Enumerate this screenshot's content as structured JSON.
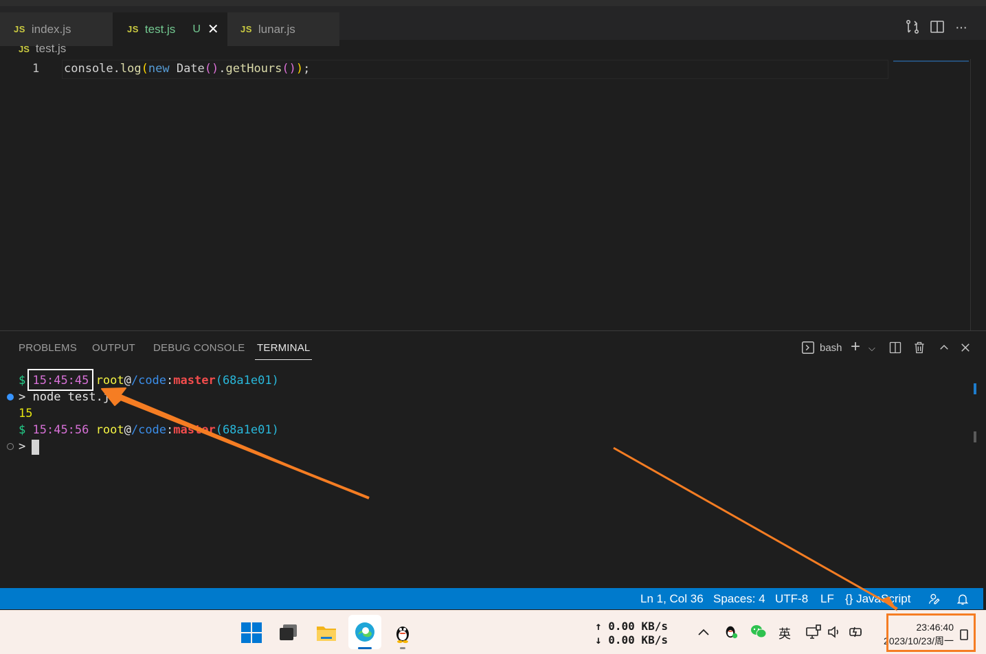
{
  "tabs": [
    {
      "icon_text": "JS",
      "label": "index.js"
    },
    {
      "icon_text": "JS",
      "label": "test.js",
      "status": "U"
    },
    {
      "icon_text": "JS",
      "label": "lunar.js"
    }
  ],
  "tab_actions": [
    "open-changes-icon",
    "split-editor-icon",
    "more-actions-icon"
  ],
  "more_glyph": "···",
  "breadcrumb": {
    "icon_text": "JS",
    "file": "test.js"
  },
  "editor": {
    "line_number": "1",
    "code": {
      "t1": "console",
      "t2": ".",
      "t3": "log",
      "t4": "(",
      "t5": "new",
      "t6": " Date",
      "t7": "()",
      "t8": ".",
      "t9": "getHours",
      "t10": "()",
      "t11": ")",
      "t12": ";"
    }
  },
  "panel": {
    "tabs": [
      "PROBLEMS",
      "OUTPUT",
      "DEBUG CONSOLE",
      "TERMINAL"
    ],
    "active_tab": "TERMINAL",
    "shell": "bash"
  },
  "terminal": {
    "prompt1": {
      "dollar": "$",
      "time": "15:45:45",
      "user": "root",
      "at": "@",
      "path": "/code",
      "colon": ":",
      "branch": "master",
      "commit": "(68a1e01)"
    },
    "cmd": {
      "arrow": ">",
      "text": "node test.js"
    },
    "output": "15",
    "prompt2": {
      "dollar": "$",
      "time": "15:45:56",
      "user": "root",
      "at": "@",
      "path": "/code",
      "colon": ":",
      "branch": "master",
      "commit": "(68a1e01)"
    },
    "cmd2": {
      "arrow": ">"
    }
  },
  "statusbar": {
    "position": "Ln 1, Col 36",
    "spaces": "Spaces: 4",
    "encoding": "UTF-8",
    "eol": "LF",
    "language": "JavaScript",
    "braces": "{}"
  },
  "taskbar": {
    "net_up": "↑ 0.00 KB/s",
    "net_down": "↓ 0.00 KB/s",
    "ime": "英",
    "time": "23:46:40",
    "date": "2023/10/23/周一"
  },
  "colors": {
    "statusbar": "#007acc",
    "taskbar": "#f9efea",
    "annotation": "#f57d23"
  }
}
